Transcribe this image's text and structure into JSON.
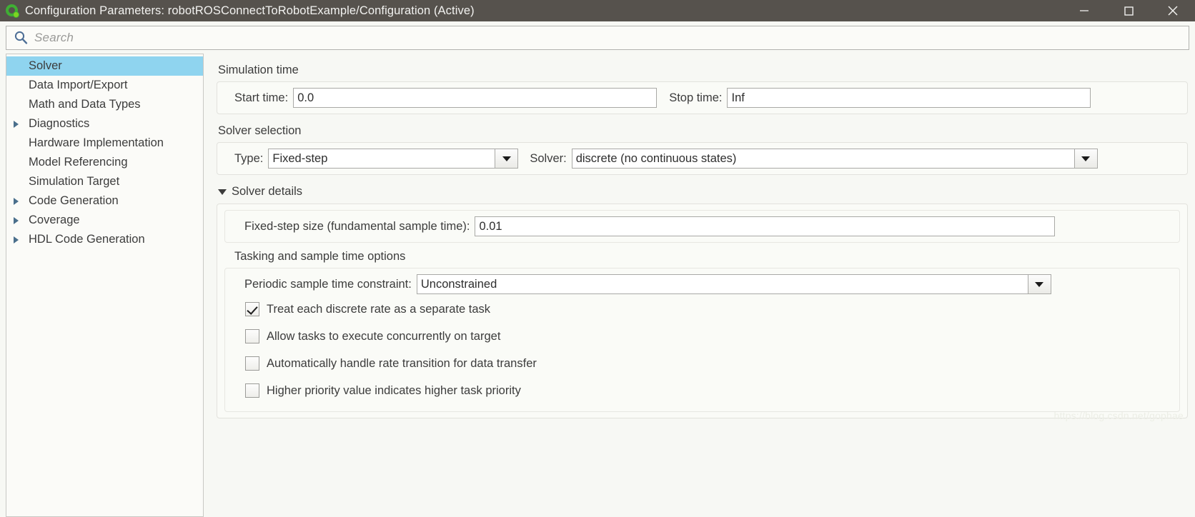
{
  "window": {
    "title": "Configuration Parameters: robotROSConnectToRobotExample/Configuration (Active)",
    "app_icon": "simulink-gear-icon",
    "controls": {
      "minimize": "minimize-icon",
      "maximize": "maximize-icon",
      "close": "close-icon"
    }
  },
  "search": {
    "icon": "search-icon",
    "placeholder": "Search",
    "value": ""
  },
  "sidebar": {
    "items": [
      {
        "label": "Solver",
        "expandable": false,
        "selected": true
      },
      {
        "label": "Data Import/Export",
        "expandable": false,
        "selected": false
      },
      {
        "label": "Math and Data Types",
        "expandable": false,
        "selected": false
      },
      {
        "label": "Diagnostics",
        "expandable": true,
        "selected": false
      },
      {
        "label": "Hardware Implementation",
        "expandable": false,
        "selected": false
      },
      {
        "label": "Model Referencing",
        "expandable": false,
        "selected": false
      },
      {
        "label": "Simulation Target",
        "expandable": false,
        "selected": false
      },
      {
        "label": "Code Generation",
        "expandable": true,
        "selected": false
      },
      {
        "label": "Coverage",
        "expandable": true,
        "selected": false
      },
      {
        "label": "HDL Code Generation",
        "expandable": true,
        "selected": false
      }
    ]
  },
  "main": {
    "simulation_time": {
      "group_title": "Simulation time",
      "start_time_label": "Start time:",
      "start_time_value": "0.0",
      "stop_time_label": "Stop time:",
      "stop_time_value": "Inf"
    },
    "solver_selection": {
      "group_title": "Solver selection",
      "type_label": "Type:",
      "type_value": "Fixed-step",
      "solver_label": "Solver:",
      "solver_value": "discrete (no continuous states)"
    },
    "solver_details": {
      "header": "Solver details",
      "expanded": true,
      "fixed_step_label": "Fixed-step size (fundamental sample time):",
      "fixed_step_value": "0.01",
      "tasking_group_title": "Tasking and sample time options",
      "periodic_label": "Periodic sample time constraint:",
      "periodic_value": "Unconstrained",
      "checkboxes": [
        {
          "label": "Treat each discrete rate as a separate task",
          "checked": true
        },
        {
          "label": "Allow tasks to execute concurrently on target",
          "checked": false
        },
        {
          "label": "Automatically handle rate transition for data transfer",
          "checked": false
        },
        {
          "label": "Higher priority value indicates higher task priority",
          "checked": false
        }
      ]
    }
  },
  "watermark": {
    "text": "https://blog.csdn.net/gophae"
  },
  "colors": {
    "titlebar_bg": "#56524d",
    "selection_bg": "#8fd4ef",
    "accent_icon": "#4a6f8c",
    "app_icon_green": "#3fae34"
  }
}
